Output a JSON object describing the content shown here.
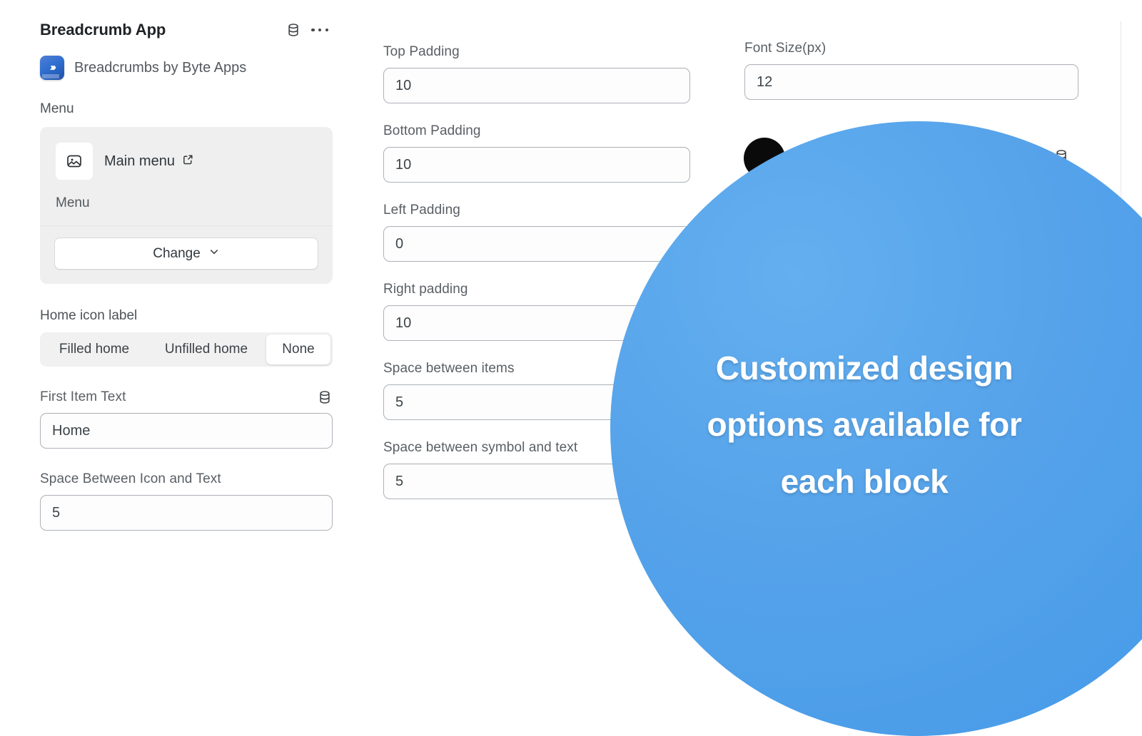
{
  "app": {
    "title": "Breadcrumb App",
    "subtitle": "Breadcrumbs by Byte Apps",
    "logo_icon": "chevron-triple-icon",
    "db_icon": "database-icon",
    "more_icon": "more-horizontal-icon"
  },
  "menu_section": {
    "label": "Menu",
    "item_name": "Main menu",
    "item_thumb_icon": "image-icon",
    "external_link_icon": "external-link-icon",
    "item_sub": "Menu",
    "change_button": "Change",
    "change_caret_icon": "chevron-down-icon"
  },
  "home_icon_label": {
    "label": "Home icon label",
    "options": [
      "Filled home",
      "Unfilled home",
      "None"
    ],
    "selected": "None"
  },
  "left_fields": [
    {
      "label": "First Item Text",
      "value": "Home",
      "db_icon": "database-icon"
    },
    {
      "label": "Space Between Icon and Text",
      "value": "5"
    }
  ],
  "middle_fields": [
    {
      "label": "Top Padding",
      "value": "10"
    },
    {
      "label": "Bottom Padding",
      "value": "10"
    },
    {
      "label": "Left Padding",
      "value": "0"
    },
    {
      "label": "Right padding",
      "value": "10"
    },
    {
      "label": "Space between items",
      "value": "5"
    },
    {
      "label": "Space between symbol and text",
      "value": "5"
    }
  ],
  "right_column": {
    "font_size_label": "Font Size(px)",
    "font_size_value": "12",
    "color_swatch_value": "#0a0a0a",
    "db_icon": "database-icon"
  },
  "overlay": {
    "line1": "Customized design",
    "line2": "options available for",
    "line3": "each block",
    "bubble_color": "#4f9fe8",
    "text_color": "#ffffff"
  }
}
